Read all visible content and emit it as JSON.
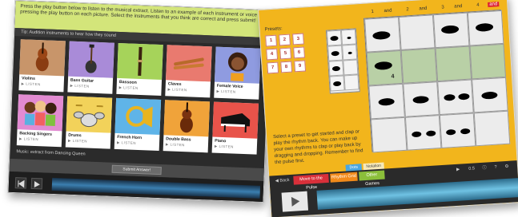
{
  "left_screen": {
    "instructions": "Press the play button below to listen to the musical extract. Listen to an example of each instrument or voice by pressing the play button on each picture. Select the instruments that you think are correct and press submit!",
    "tip": "Tip: Audition instruments to hear how they sound",
    "tiles": [
      {
        "name": "Violins",
        "listen": "▶ LISTEN",
        "bg": "#c8956a",
        "icon": "violin-icon"
      },
      {
        "name": "Bass Guitar",
        "listen": "▶ LISTEN",
        "bg": "#a98bd8",
        "icon": "bass-guitar-icon"
      },
      {
        "name": "Bassoon",
        "listen": "▶ LISTEN",
        "bg": "#a6d35a",
        "icon": "bassoon-icon"
      },
      {
        "name": "Claves",
        "listen": "▶ LISTEN",
        "bg": "#e97a6f",
        "icon": "claves-icon"
      },
      {
        "name": "Female Voice",
        "listen": "▶ LISTEN",
        "bg": "#8f9be0",
        "icon": "female-voice-icon"
      },
      {
        "name": "Backing Singers",
        "listen": "▶ LISTEN",
        "bg": "#e28bd2",
        "icon": "backing-singers-icon"
      },
      {
        "name": "Drums",
        "listen": "▶ LISTEN",
        "bg": "#f2d25a",
        "icon": "drums-icon"
      },
      {
        "name": "French Horn",
        "listen": "▶ LISTEN",
        "bg": "#5fb4e8",
        "icon": "french-horn-icon"
      },
      {
        "name": "Double Bass",
        "listen": "▶ LISTEN",
        "bg": "#f0a33a",
        "icon": "double-bass-icon"
      },
      {
        "name": "Piano",
        "listen": "▶ LISTEN",
        "bg": "#e8534a",
        "icon": "piano-icon"
      }
    ],
    "music_label": "Music: extract from Dancing Queen",
    "submit_label": "Submit Answer!"
  },
  "right_screen": {
    "presets_label": "Presets:",
    "presets": [
      "1",
      "2",
      "3",
      "4",
      "5",
      "6",
      "7",
      "8",
      "9"
    ],
    "beat_header": [
      "1",
      "and",
      "2",
      "and",
      "3",
      "and",
      "4",
      "and"
    ],
    "instructions": "Select a preset to get started and clap or play the rhythm back. You can make up your own rhythms to clap or play back by dragging and dropping. Remember to find the pulse first.",
    "view_toggle": [
      "Dots",
      "Notation"
    ],
    "back_label": "◀ Back",
    "move_label": "Move to the Pulse",
    "rhythm_grid_label": "Rhythm Grid",
    "other_games_label": "Other Games",
    "tempo_label": "0.5",
    "number_marker": "4",
    "colors": {
      "orange": "#f2b51c",
      "grid_green": "#b9d0a6",
      "button_red": "#d9303a",
      "button_orange": "#f28a1a",
      "button_green": "#8bbf3a"
    }
  }
}
